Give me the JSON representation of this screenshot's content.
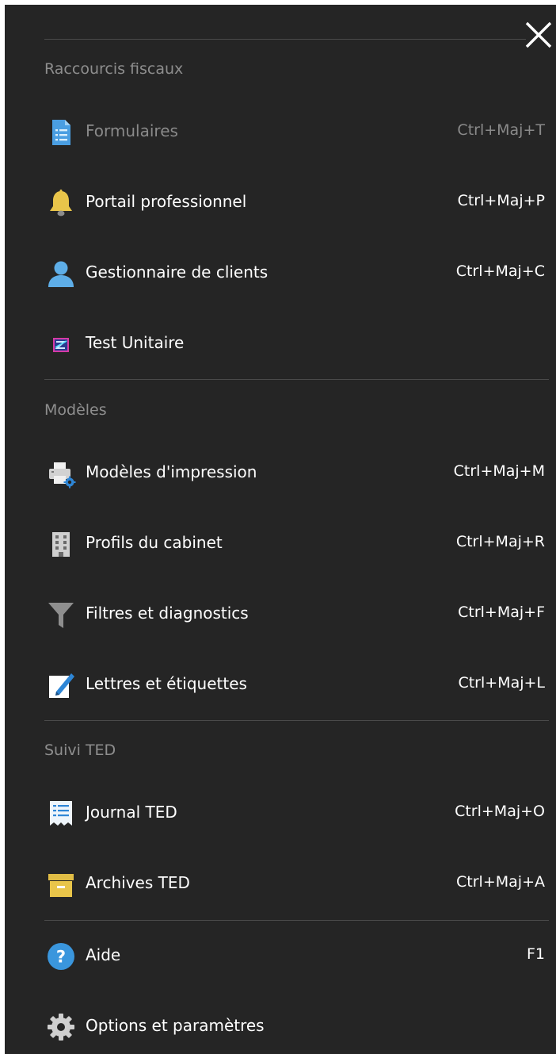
{
  "sections": {
    "tax_shortcuts": {
      "title": "Raccourcis fiscaux",
      "items": [
        {
          "label": "Formulaires",
          "shortcut": "Ctrl+Maj+T",
          "icon": "form-document-icon",
          "enabled": false
        },
        {
          "label": "Portail professionnel",
          "shortcut": "Ctrl+Maj+P",
          "icon": "bell-icon",
          "enabled": true
        },
        {
          "label": "Gestionnaire de clients",
          "shortcut": "Ctrl+Maj+C",
          "icon": "client-person-icon",
          "enabled": true
        },
        {
          "label": "Test Unitaire",
          "shortcut": "",
          "icon": "unit-test-icon",
          "enabled": true
        }
      ]
    },
    "templates": {
      "title": "Modèles",
      "items": [
        {
          "label": "Modèles d'impression",
          "shortcut": "Ctrl+Maj+M",
          "icon": "printer-settings-icon"
        },
        {
          "label": "Profils du cabinet",
          "shortcut": "Ctrl+Maj+R",
          "icon": "building-icon"
        },
        {
          "label": "Filtres et diagnostics",
          "shortcut": "Ctrl+Maj+F",
          "icon": "funnel-filter-icon"
        },
        {
          "label": "Lettres et étiquettes",
          "shortcut": "Ctrl+Maj+L",
          "icon": "edit-letter-icon"
        }
      ]
    },
    "efile": {
      "title": "Suivi TED",
      "items": [
        {
          "label": "Journal TED",
          "shortcut": "Ctrl+Maj+O",
          "icon": "receipt-journal-icon"
        },
        {
          "label": "Archives TED",
          "shortcut": "Ctrl+Maj+A",
          "icon": "archive-box-icon"
        }
      ]
    },
    "misc": {
      "items": [
        {
          "label": "Aide",
          "shortcut": "F1",
          "icon": "help-icon"
        },
        {
          "label": "Options et paramètres",
          "shortcut": "",
          "icon": "gear-icon"
        }
      ]
    }
  },
  "colors": {
    "background": "#252525",
    "text": "#ffffff",
    "muted_text": "#8e8e8e",
    "divider": "#4a4a4a",
    "accent_blue": "#3a96dd",
    "accent_yellow": "#e9c54a"
  }
}
